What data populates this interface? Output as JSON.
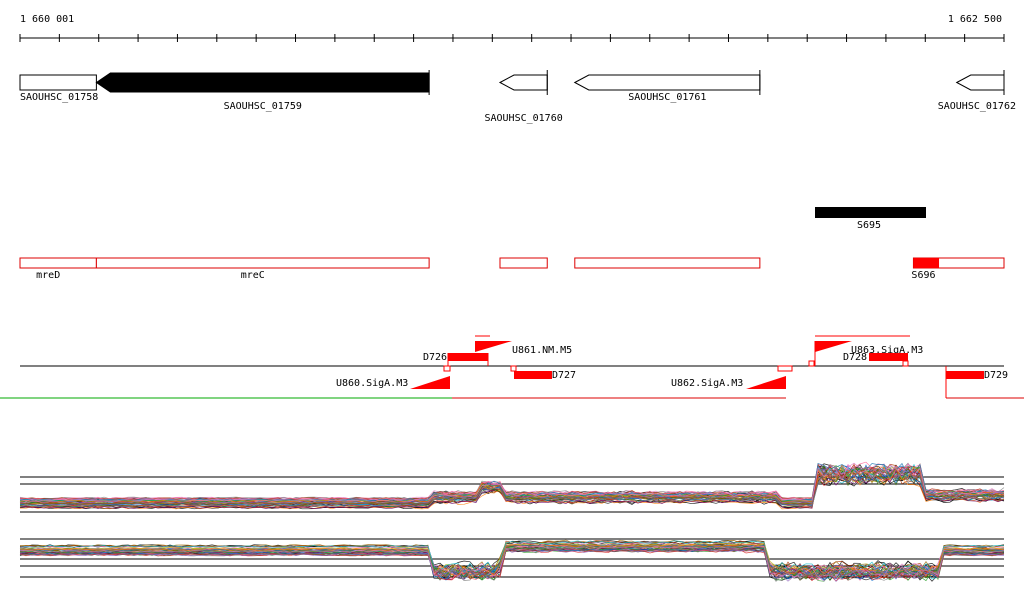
{
  "ruler": {
    "start_label": "1 660 001",
    "end_label": "1 662 500",
    "start": 1660001,
    "end": 1662500
  },
  "genes": [
    {
      "name": "SAOUHSC_01758",
      "start": 1660001,
      "end": 1660195,
      "strand": "+",
      "highlight": false
    },
    {
      "name": "SAOUHSC_01759",
      "start": 1660195,
      "end": 1661040,
      "strand": "-",
      "highlight": true
    },
    {
      "name": "SAOUHSC_01760",
      "start": 1661220,
      "end": 1661340,
      "strand": "-",
      "highlight": false
    },
    {
      "name": "SAOUHSC_01761",
      "start": 1661410,
      "end": 1661880,
      "strand": "-",
      "highlight": false
    },
    {
      "name": "SAOUHSC_01762",
      "start": 1662380,
      "end": 1662500,
      "strand": "-",
      "highlight": false
    }
  ],
  "small_rna": {
    "name": "S695",
    "start": 1662010,
    "end": 1662290
  },
  "operons": [
    {
      "name": "mreD",
      "start": 1660001,
      "end": 1660195,
      "filled": false
    },
    {
      "name": "mreC",
      "start": 1660195,
      "end": 1661040,
      "filled": false
    },
    {
      "name": "",
      "start": 1661220,
      "end": 1661340,
      "filled": false
    },
    {
      "name": "",
      "start": 1661410,
      "end": 1661880,
      "filled": false
    },
    {
      "name": "S696",
      "start": 1662270,
      "end": 1662500,
      "filled_start": 1662270,
      "filled_end": 1662335
    }
  ],
  "features": {
    "D726": "D726",
    "U861": "U861.NM.M5",
    "D727": "D727",
    "U860": "U860.SigA.M3",
    "U862": "U862.SigA.M3",
    "U863": "U863.SigA.M3",
    "D728": "D728",
    "D729": "D729"
  },
  "colors": {
    "gene_outline": "#000000",
    "gene_fill_highlight": "#000000",
    "operon": "#dd0000",
    "feature": "#ff0000",
    "green_line": "#00aa00"
  }
}
